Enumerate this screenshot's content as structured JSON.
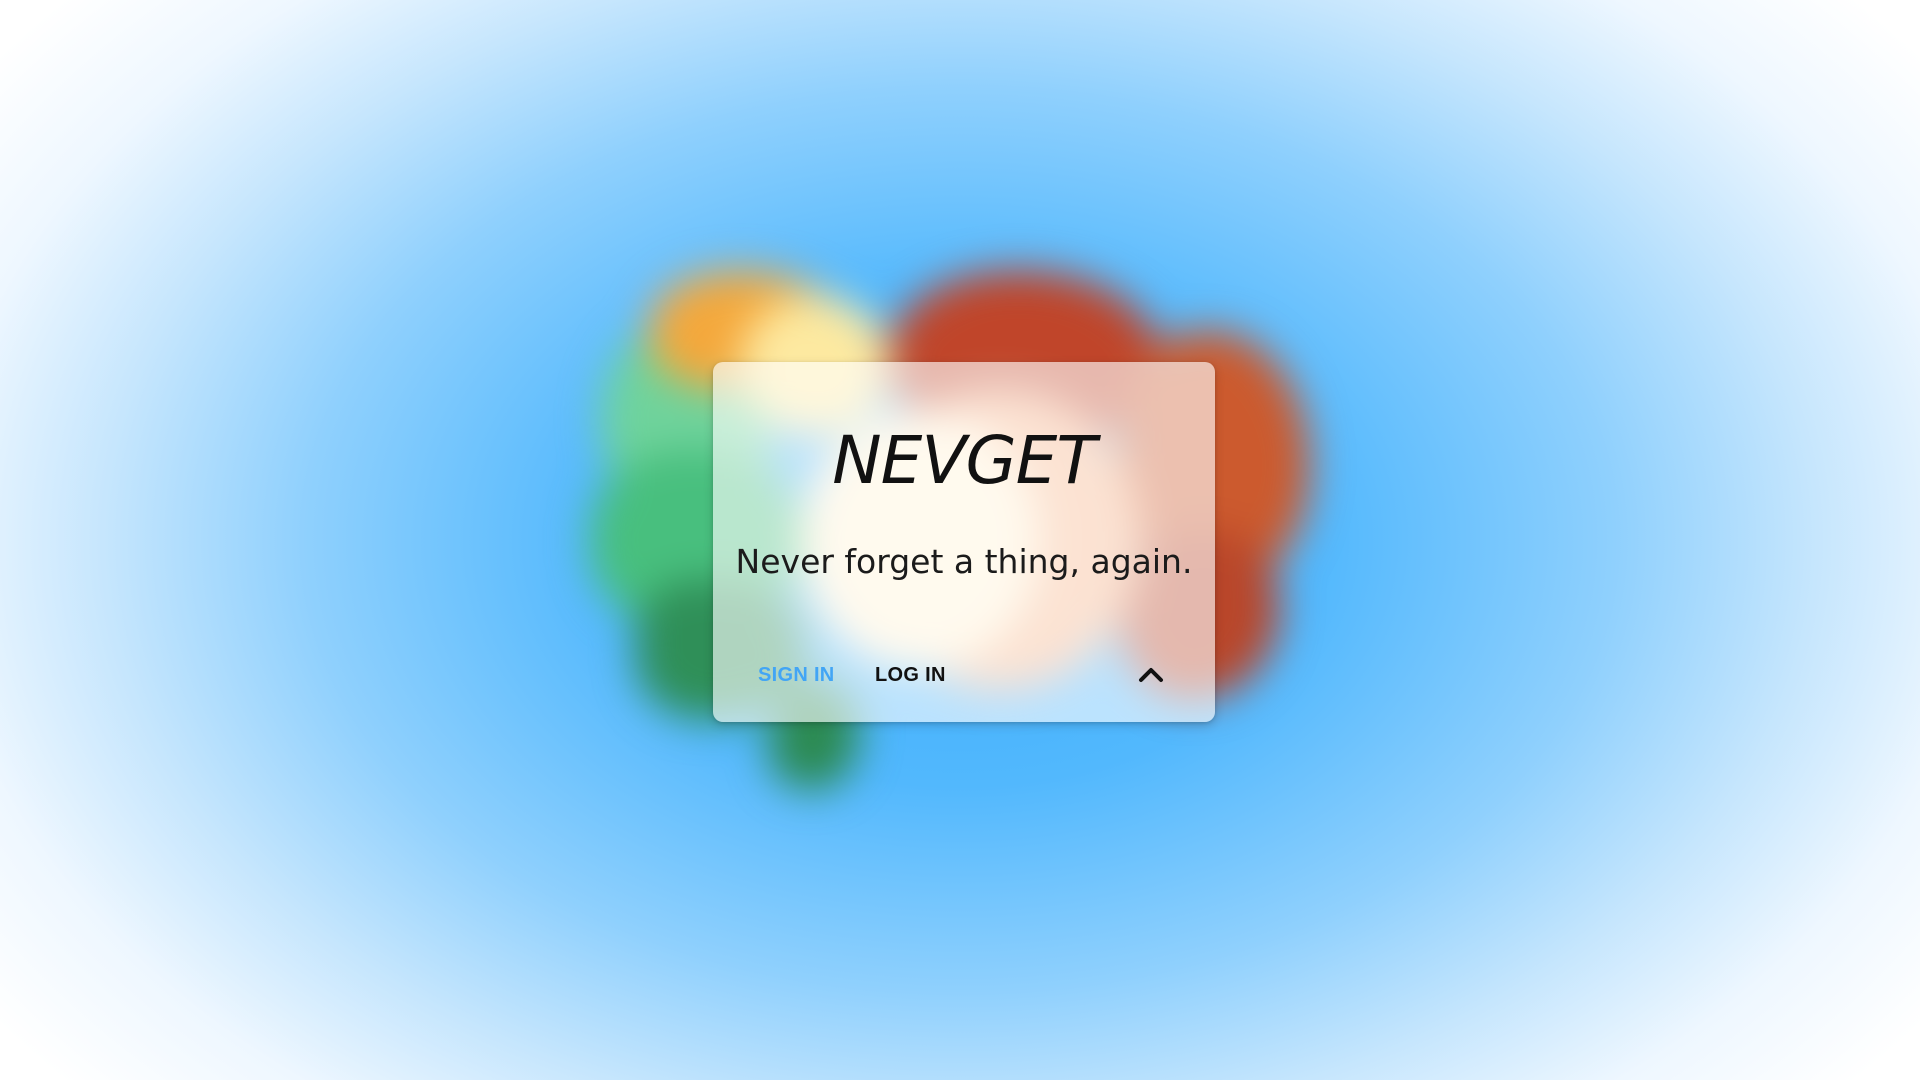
{
  "app": {
    "title": "NEVGET",
    "tagline": "Never forget a thing, again."
  },
  "actions": {
    "sign_in_label": "SIGN IN",
    "log_in_label": "LOG IN",
    "expand_icon": "chevron-up-icon"
  },
  "colors": {
    "accent": "#42a5f5",
    "text": "#111111",
    "background": "#3aaefc"
  }
}
